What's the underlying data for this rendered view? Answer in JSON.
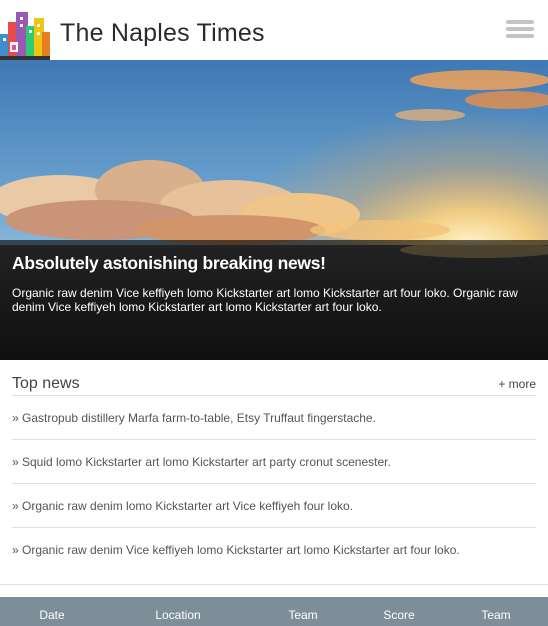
{
  "header": {
    "title": "The Naples Times",
    "logo_icon": "city-buildings-icon",
    "menu_icon": "hamburger-menu-icon"
  },
  "hero": {
    "title": "Absolutely astonishing breaking news!",
    "text": "Organic raw denim Vice keffiyeh lomo Kickstarter art lomo Kickstarter art four loko. Organic raw denim Vice keffiyeh lomo Kickstarter art lomo Kickstarter art four loko."
  },
  "top_news": {
    "title": "Top news",
    "more_label": "+ more",
    "items": [
      "» Gastropub distillery Marfa farm-to-table, Etsy Truffaut fingerstache.",
      "» Squid lomo Kickstarter art lomo Kickstarter art party cronut scenester.",
      "» Organic raw denim lomo Kickstarter art Vice keffiyeh four loko.",
      "» Organic raw denim Vice keffiyeh lomo Kickstarter art lomo Kickstarter art four loko."
    ]
  },
  "table": {
    "columns": [
      "Date",
      "Location",
      "Team",
      "Score",
      "Team"
    ]
  },
  "colors": {
    "table_header_bg": "#7d8e99",
    "caption_overlay": "rgba(0,0,0,0.62)"
  }
}
